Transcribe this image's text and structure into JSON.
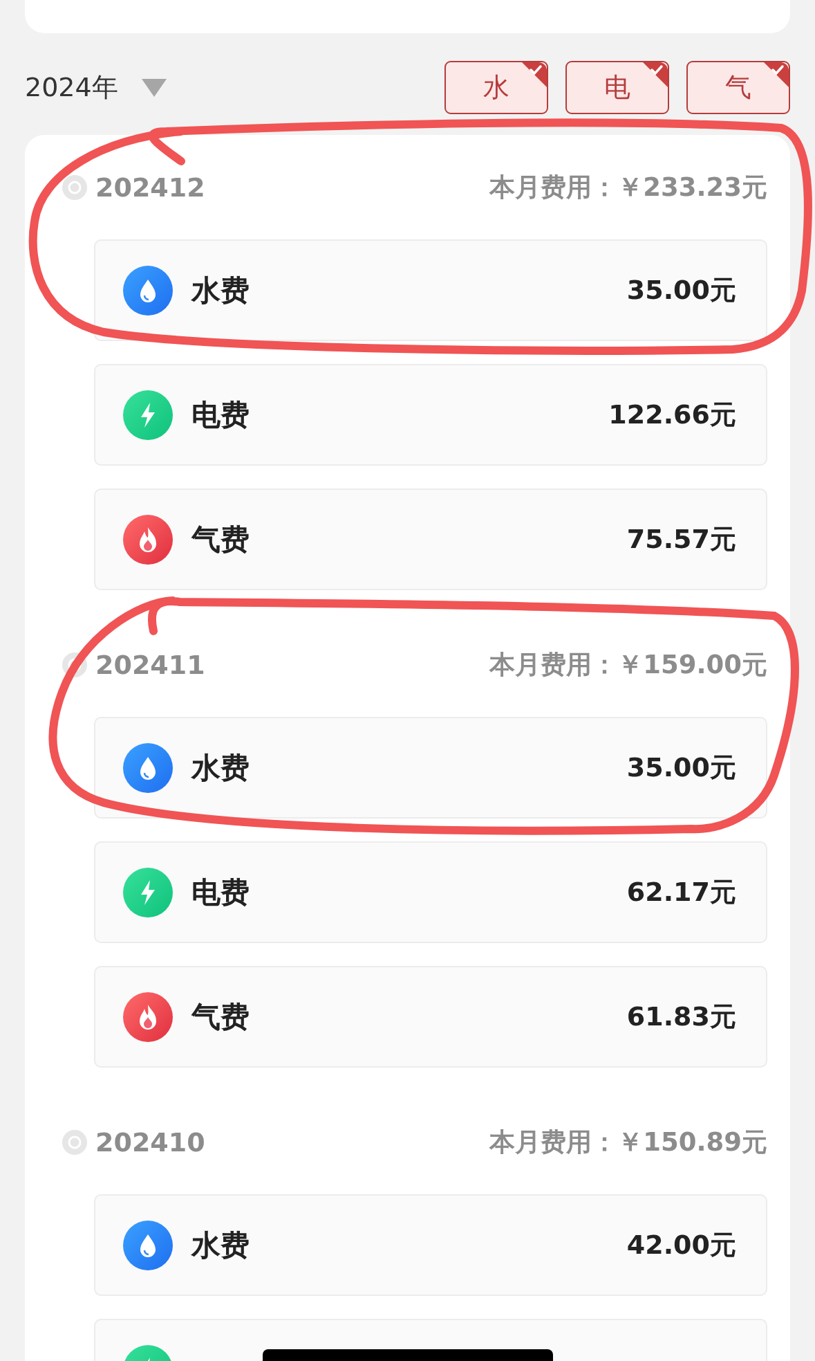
{
  "year": {
    "label": "2024年"
  },
  "filters": [
    {
      "label": "水",
      "selected": true
    },
    {
      "label": "电",
      "selected": true
    },
    {
      "label": "气",
      "selected": true
    }
  ],
  "months": [
    {
      "month": "202412",
      "total": "本月费用：￥233.23元",
      "items": [
        {
          "kind": "water",
          "label": "水费",
          "amount": "35.00元"
        },
        {
          "kind": "electric",
          "label": "电费",
          "amount": "122.66元"
        },
        {
          "kind": "gas",
          "label": "气费",
          "amount": "75.57元"
        }
      ]
    },
    {
      "month": "202411",
      "total": "本月费用：￥159.00元",
      "items": [
        {
          "kind": "water",
          "label": "水费",
          "amount": "35.00元"
        },
        {
          "kind": "electric",
          "label": "电费",
          "amount": "62.17元"
        },
        {
          "kind": "gas",
          "label": "气费",
          "amount": "61.83元"
        }
      ]
    },
    {
      "month": "202410",
      "total": "本月费用：￥150.89元",
      "items": [
        {
          "kind": "water",
          "label": "水费",
          "amount": "42.00元"
        },
        {
          "kind": "electric",
          "redacted": true
        }
      ]
    }
  ]
}
